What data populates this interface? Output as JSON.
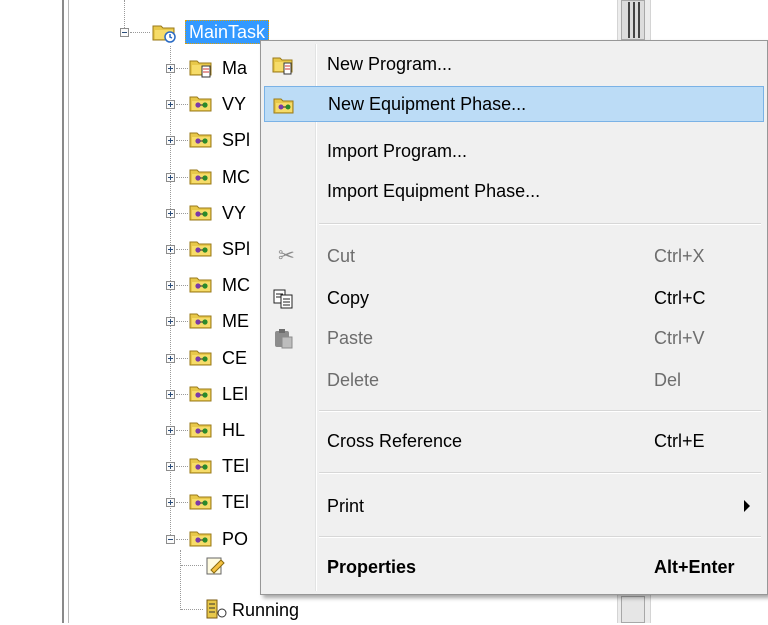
{
  "tree": {
    "task_label": "MainTask",
    "items": [
      {
        "label": "Ma",
        "icon": "program-folder-icon"
      },
      {
        "label": "VY",
        "icon": "phase-folder-icon"
      },
      {
        "label": "SPl",
        "icon": "phase-folder-icon"
      },
      {
        "label": "MC",
        "icon": "phase-folder-icon"
      },
      {
        "label": "VY",
        "icon": "phase-folder-icon"
      },
      {
        "label": "SPl",
        "icon": "phase-folder-icon"
      },
      {
        "label": "MC",
        "icon": "phase-folder-icon"
      },
      {
        "label": "ME",
        "icon": "phase-folder-icon"
      },
      {
        "label": "CE",
        "icon": "phase-folder-icon"
      },
      {
        "label": "LEl",
        "icon": "phase-folder-icon"
      },
      {
        "label": "HL",
        "icon": "phase-folder-icon"
      },
      {
        "label": "TEl",
        "icon": "phase-folder-icon"
      },
      {
        "label": "TEl",
        "icon": "phase-folder-icon"
      },
      {
        "label": "PO",
        "icon": "phase-folder-icon"
      }
    ],
    "child_running_label": "Running"
  },
  "menu": {
    "new_program": "New Program...",
    "new_equipment_phase": "New Equipment Phase...",
    "import_program": "Import Program...",
    "import_equipment_phase": "Import Equipment Phase...",
    "cut": "Cut",
    "cut_shortcut": "Ctrl+X",
    "copy": "Copy",
    "copy_shortcut": "Ctrl+C",
    "paste": "Paste",
    "paste_shortcut": "Ctrl+V",
    "delete": "Delete",
    "delete_shortcut": "Del",
    "cross_reference": "Cross Reference",
    "cross_reference_shortcut": "Ctrl+E",
    "print": "Print",
    "properties": "Properties",
    "properties_shortcut": "Alt+Enter"
  },
  "colors": {
    "highlight": "#bcdcf6",
    "selection": "#3399ff",
    "folder": "#e8c84a"
  }
}
